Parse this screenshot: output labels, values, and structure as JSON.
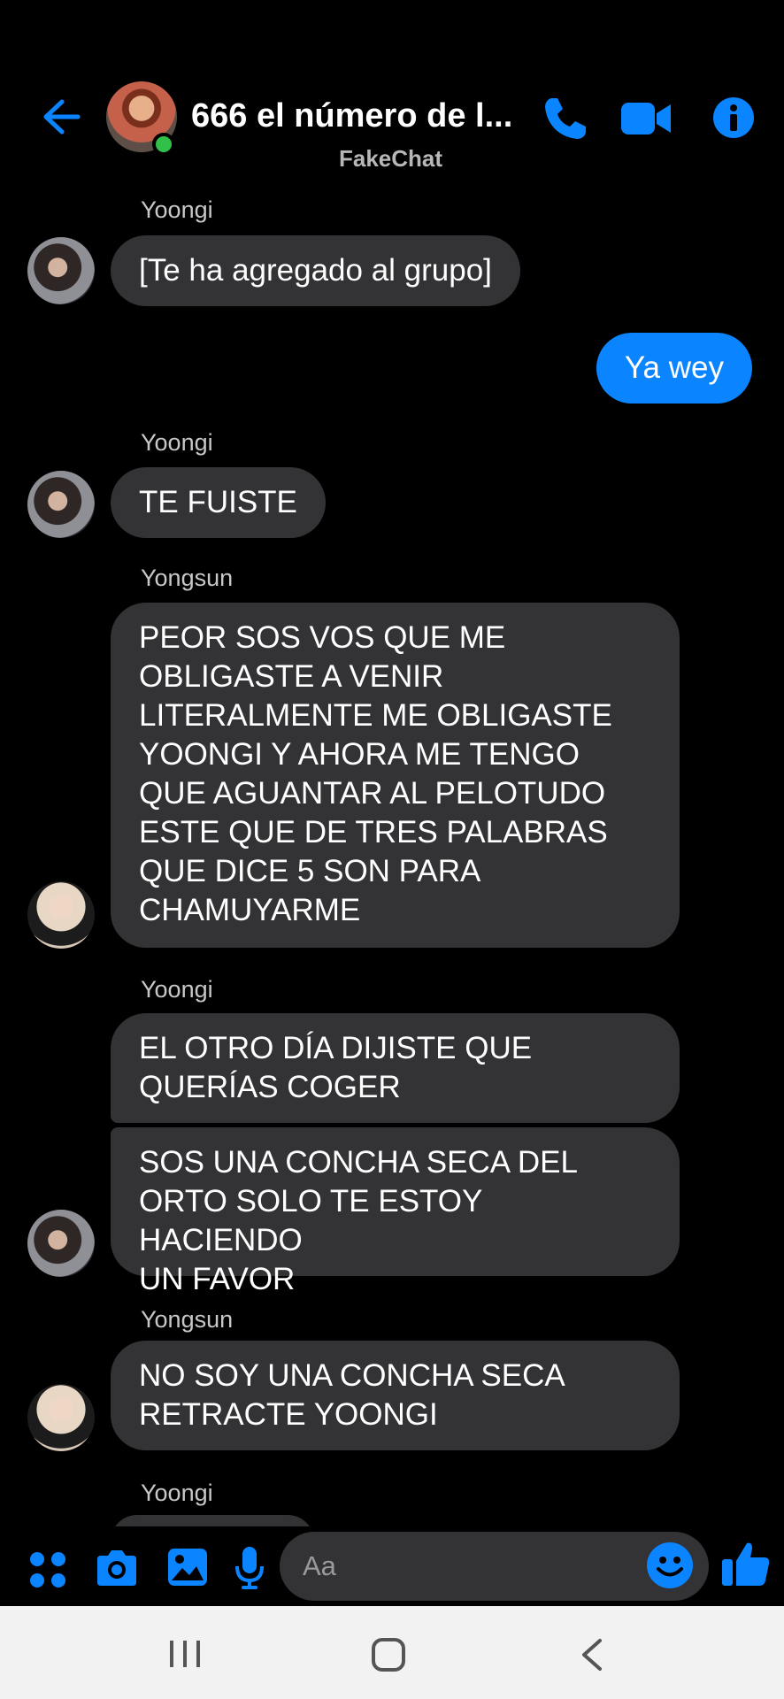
{
  "header": {
    "title": "666 el número de l...",
    "subtitle": "FakeChat",
    "icons": [
      "back-arrow-icon",
      "phone-icon",
      "video-camera-icon",
      "info-icon"
    ]
  },
  "messages": [
    {
      "sender": "Yoongi",
      "text": "[Te ha agregado al grupo]"
    },
    {
      "sender": "",
      "text": "Ya wey",
      "outgoing": true
    },
    {
      "sender": "Yoongi",
      "text": "TE FUISTE"
    },
    {
      "sender": "Yongsun",
      "lines": [
        "PEOR SOS VOS QUE ME",
        "OBLIGASTE A VENIR",
        "LITERALMENTE ME OBLIGASTE",
        "YOONGI Y AHORA ME TENGO",
        "QUE AGUANTAR AL PELOTUDO",
        "ESTE QUE DE TRES PALABRAS",
        "QUE DICE 5 SON PARA",
        "CHAMUYARME"
      ]
    },
    {
      "sender": "Yoongi",
      "lines": [
        "EL OTRO DÍA DIJISTE QUE",
        "QUERÍAS COGER"
      ]
    },
    {
      "sender": "",
      "lines": [
        "SOS UNA CONCHA SECA DEL",
        "ORTO SOLO TE ESTOY HACIENDO",
        "UN FAVOR"
      ]
    },
    {
      "sender": "Yongsun",
      "lines": [
        "NO SOY UNA CONCHA SECA",
        "RETRACTE YOONGI"
      ]
    },
    {
      "sender": "Yoongi",
      "text": ""
    }
  ],
  "composer": {
    "placeholder": "Aa",
    "icons": [
      "apps-icon",
      "camera-icon",
      "gallery-icon",
      "microphone-icon",
      "emoji-icon",
      "thumbs-up-icon"
    ]
  },
  "colors": {
    "background": "#000000",
    "accent": "#0a84ff",
    "incoming_bubble": "#333335",
    "online": "#31c14a"
  }
}
